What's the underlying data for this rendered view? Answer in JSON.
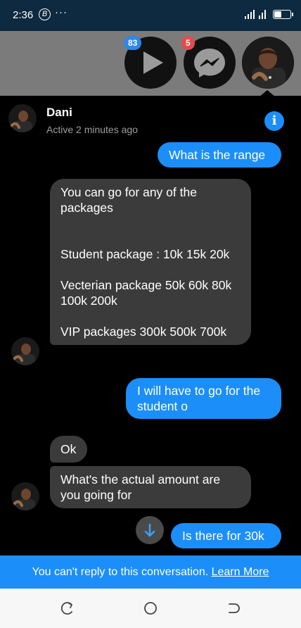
{
  "status_bar": {
    "time": "2:36",
    "b_icon": "B",
    "dots": "···"
  },
  "chat_heads": {
    "video_badge": "83",
    "messenger_badge": "5"
  },
  "header": {
    "name": "Dani",
    "status": "Active 2 minutes ago"
  },
  "messages": [
    {
      "side": "out",
      "text": "What is the range"
    },
    {
      "side": "in",
      "text": "You can go for any of the packages\n\n\nStudent package : 10k 15k 20k\n\nVecterian package 50k 60k 80k 100k 200k\n\nVIP packages 300k 500k 700k"
    },
    {
      "side": "out",
      "text": "I will have to go for the student o"
    },
    {
      "side": "in",
      "text": "Ok"
    },
    {
      "side": "in",
      "text": "What's the actual amount are you going for"
    },
    {
      "side": "out",
      "text": "Is there for 30k"
    }
  ],
  "banner": {
    "text": "You can't reply to this conversation.",
    "link": "Learn More"
  },
  "colors": {
    "accent": "#1c8ef9",
    "incoming_bubble": "#3b3b3b",
    "status_bar": "#0d2a40"
  },
  "icons": [
    "play-icon",
    "messenger-icon",
    "info-icon",
    "arrow-down-icon",
    "back-icon",
    "home-icon",
    "recent-apps-icon"
  ]
}
